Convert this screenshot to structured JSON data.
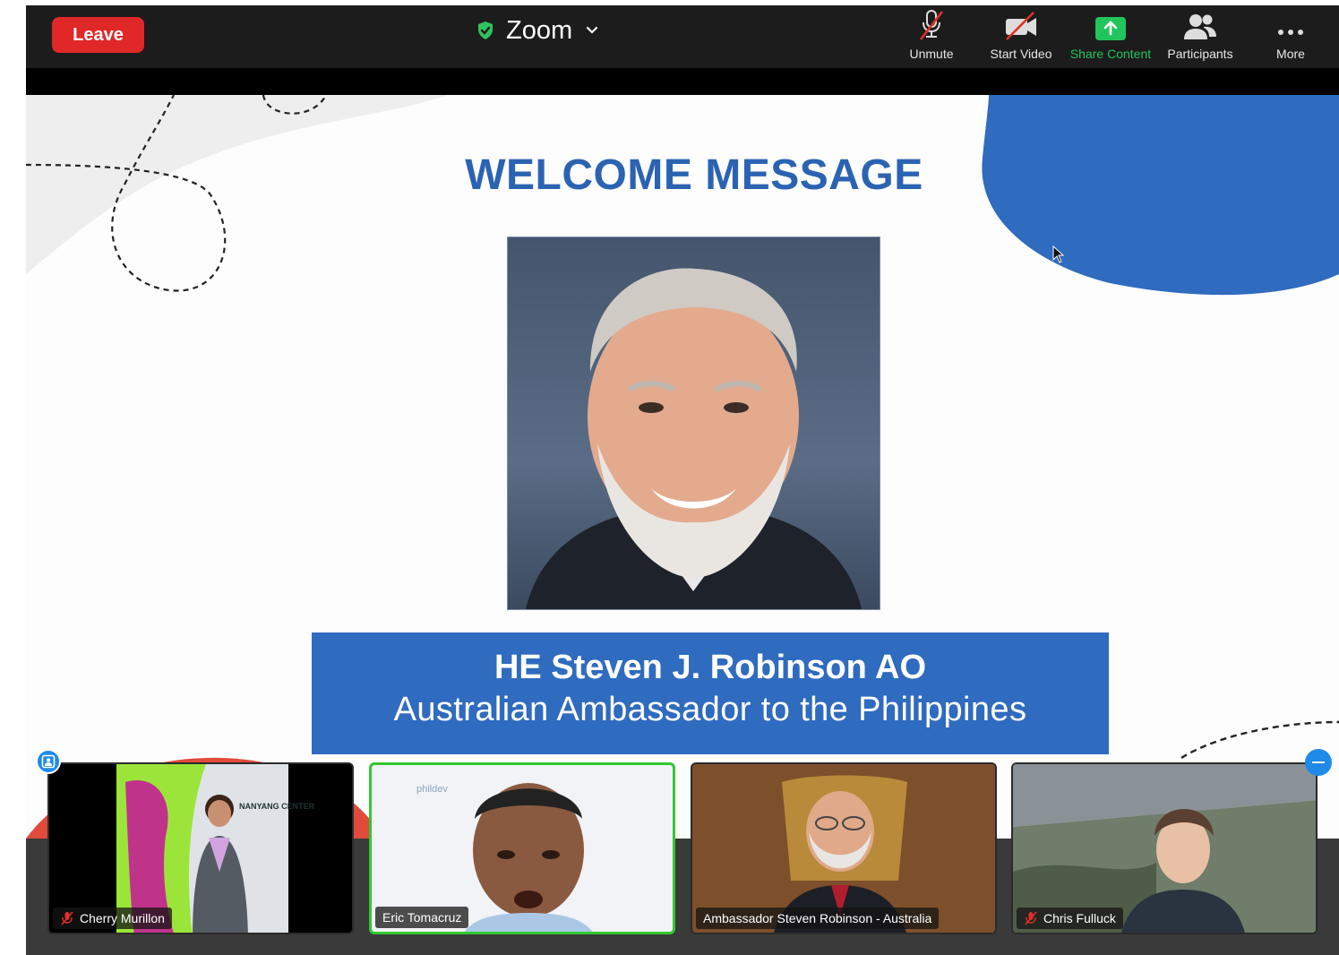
{
  "toolbar": {
    "leave_label": "Leave",
    "app_title": "Zoom",
    "buttons": {
      "unmute": "Unmute",
      "start_video": "Start Video",
      "share_content": "Share Content",
      "participants": "Participants",
      "more": "More"
    }
  },
  "slide": {
    "title": "WELCOME MESSAGE",
    "caption_name": "HE Steven J. Robinson AO",
    "caption_role": "Australian Ambassador to the Philippines"
  },
  "participants": [
    {
      "name": "Cherry Murillon",
      "muted": true
    },
    {
      "name": "Eric Tomacruz",
      "muted": false,
      "active_speaker": true
    },
    {
      "name": "Ambassador Steven Robinson - Australia",
      "muted": false
    },
    {
      "name": "Chris Fulluck",
      "muted": true
    }
  ],
  "background_text": {
    "center_sign": "NANYANG CENTER",
    "phildev": "phildev"
  },
  "colors": {
    "leave": "#e02828",
    "share_accent": "#21c55d",
    "slide_blue": "#2b63b3",
    "caption_bg": "#2f6bbf",
    "active_border": "#32c832",
    "mic_muted": "#e0302a"
  }
}
